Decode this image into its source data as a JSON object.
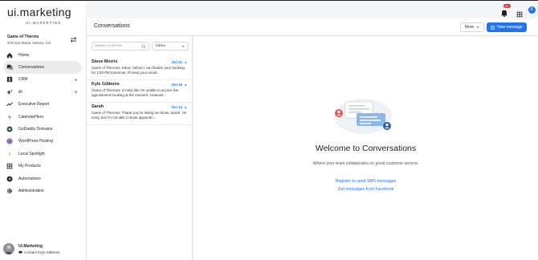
{
  "app": {
    "brand": "ui.marketing",
    "brand_sub": "UI.MARKETING"
  },
  "business": {
    "name": "Game of Therms",
    "address": "470 Inca Street, Denver, CO"
  },
  "sidebar": {
    "items": [
      {
        "label": "Home",
        "icon": "home-icon"
      },
      {
        "label": "Conversations",
        "icon": "chat-icon",
        "active": true
      },
      {
        "label": "CRM",
        "icon": "contacts-icon",
        "expandable": true
      },
      {
        "label": "AI",
        "icon": "sparkle-icon",
        "expandable": true
      },
      {
        "label": "Executive Report",
        "icon": "trend-icon"
      },
      {
        "label": "CalendarHero",
        "icon": "calendarhero-icon"
      },
      {
        "label": "GoDaddy Domains",
        "icon": "godaddy-icon"
      },
      {
        "label": "WordPress Hosting",
        "icon": "wordpress-icon"
      },
      {
        "label": "Local Spotlight",
        "icon": "spotlight-icon"
      },
      {
        "label": "My Products",
        "icon": "grid-icon"
      },
      {
        "label": "Automations",
        "icon": "automations-icon"
      },
      {
        "label": "Administration",
        "icon": "gear-icon"
      }
    ]
  },
  "footer": {
    "name": "Ui.Marketing",
    "contact": "Contact Kyle Gibbons"
  },
  "topbar": {
    "notification_count": "10+",
    "avatar_initial": "K"
  },
  "header": {
    "title": "Conversations",
    "more_label": "More",
    "new_message_label": "New message"
  },
  "list": {
    "search_placeholder": "Name or phone",
    "filter_value": "Inbox",
    "conversations": [
      {
        "name": "Steve Morris",
        "date": "Oct 21",
        "preview": "Game of Thermes: Steve, before I can finalize your booking for 1:00 PM tomorrow, I'll need your email..."
      },
      {
        "name": "Kyle Gibbons",
        "date": "Oct 16",
        "preview": "Game of Thermes: It looks like I'm unable to access live appointment booking at the moment. However..."
      },
      {
        "name": "Sarah",
        "date": "Oct 14",
        "preview": "Game of Thermes: Thank you for letting me know, Sarah. I'm sorry, but I'm not able to book appointm..."
      }
    ]
  },
  "welcome": {
    "title": "Welcome to Conversations",
    "subtitle": "Where your team collaborates on great customer service.",
    "link_sms": "Register to send SMS messages",
    "link_facebook": "Get messages from Facebook"
  },
  "colors": {
    "accent": "#1e74e8",
    "badge": "#e0242b",
    "active_nav_bg": "#ececec"
  }
}
